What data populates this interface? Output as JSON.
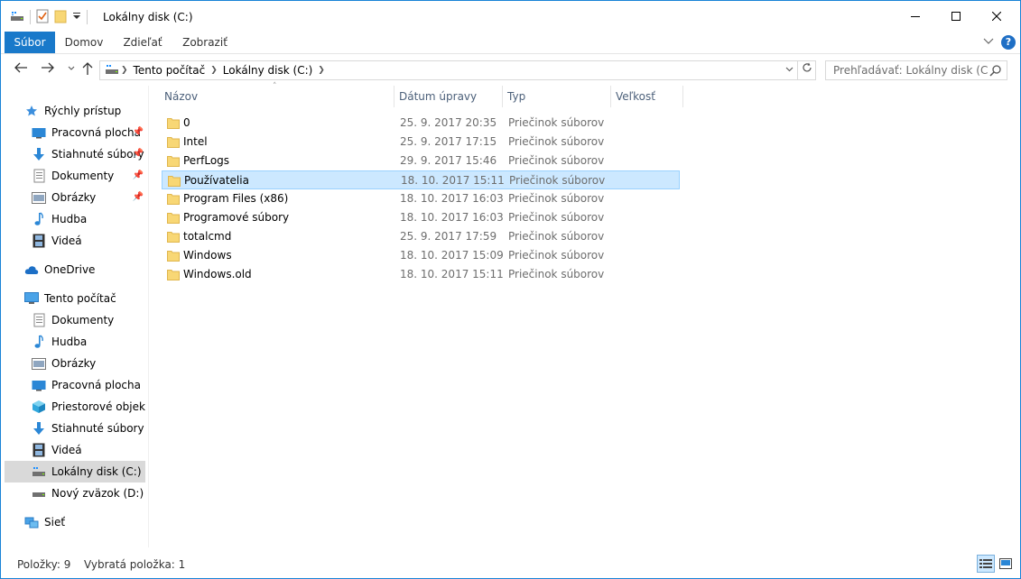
{
  "window": {
    "title": "Lokálny disk (C:)",
    "accent": "#1979ca"
  },
  "ribbon": {
    "tabs": [
      "Súbor",
      "Domov",
      "Zdieľať",
      "Zobraziť"
    ],
    "help_label": "?"
  },
  "address": {
    "crumbs": [
      "Tento počítač",
      "Lokálny disk (C:)"
    ],
    "search_placeholder": "Prehľadávať: Lokálny disk (C:)"
  },
  "navpane": {
    "quick_access": "Rýchly prístup",
    "quick_items": [
      "Pracovná plocha",
      "Stiahnuté súbory",
      "Dokumenty",
      "Obrázky",
      "Hudba",
      "Videá"
    ],
    "onedrive": "OneDrive",
    "this_pc": "Tento počítač",
    "pc_items": [
      "Dokumenty",
      "Hudba",
      "Obrázky",
      "Pracovná plocha",
      "Priestorové objekty",
      "Stiahnuté súbory",
      "Videá",
      "Lokálny disk (C:)",
      "Nový zväzok (D:)"
    ],
    "network": "Sieť"
  },
  "columns": [
    "Názov",
    "Dátum úpravy",
    "Typ",
    "Veľkosť"
  ],
  "files": [
    {
      "name": "0",
      "date": "25. 9. 2017 20:35",
      "type": "Priečinok súborov"
    },
    {
      "name": "Intel",
      "date": "25. 9. 2017 17:15",
      "type": "Priečinok súborov"
    },
    {
      "name": "PerfLogs",
      "date": "29. 9. 2017 15:46",
      "type": "Priečinok súborov"
    },
    {
      "name": "Používatelia",
      "date": "18. 10. 2017 15:11",
      "type": "Priečinok súborov"
    },
    {
      "name": "Program Files (x86)",
      "date": "18. 10. 2017 16:03",
      "type": "Priečinok súborov"
    },
    {
      "name": "Programové súbory",
      "date": "18. 10. 2017 16:03",
      "type": "Priečinok súborov"
    },
    {
      "name": "totalcmd",
      "date": "25. 9. 2017 17:59",
      "type": "Priečinok súborov"
    },
    {
      "name": "Windows",
      "date": "18. 10. 2017 15:09",
      "type": "Priečinok súborov"
    },
    {
      "name": "Windows.old",
      "date": "18. 10. 2017 15:11",
      "type": "Priečinok súborov"
    }
  ],
  "status": {
    "items": "Položky: 9",
    "selected": "Vybratá položka: 1"
  }
}
